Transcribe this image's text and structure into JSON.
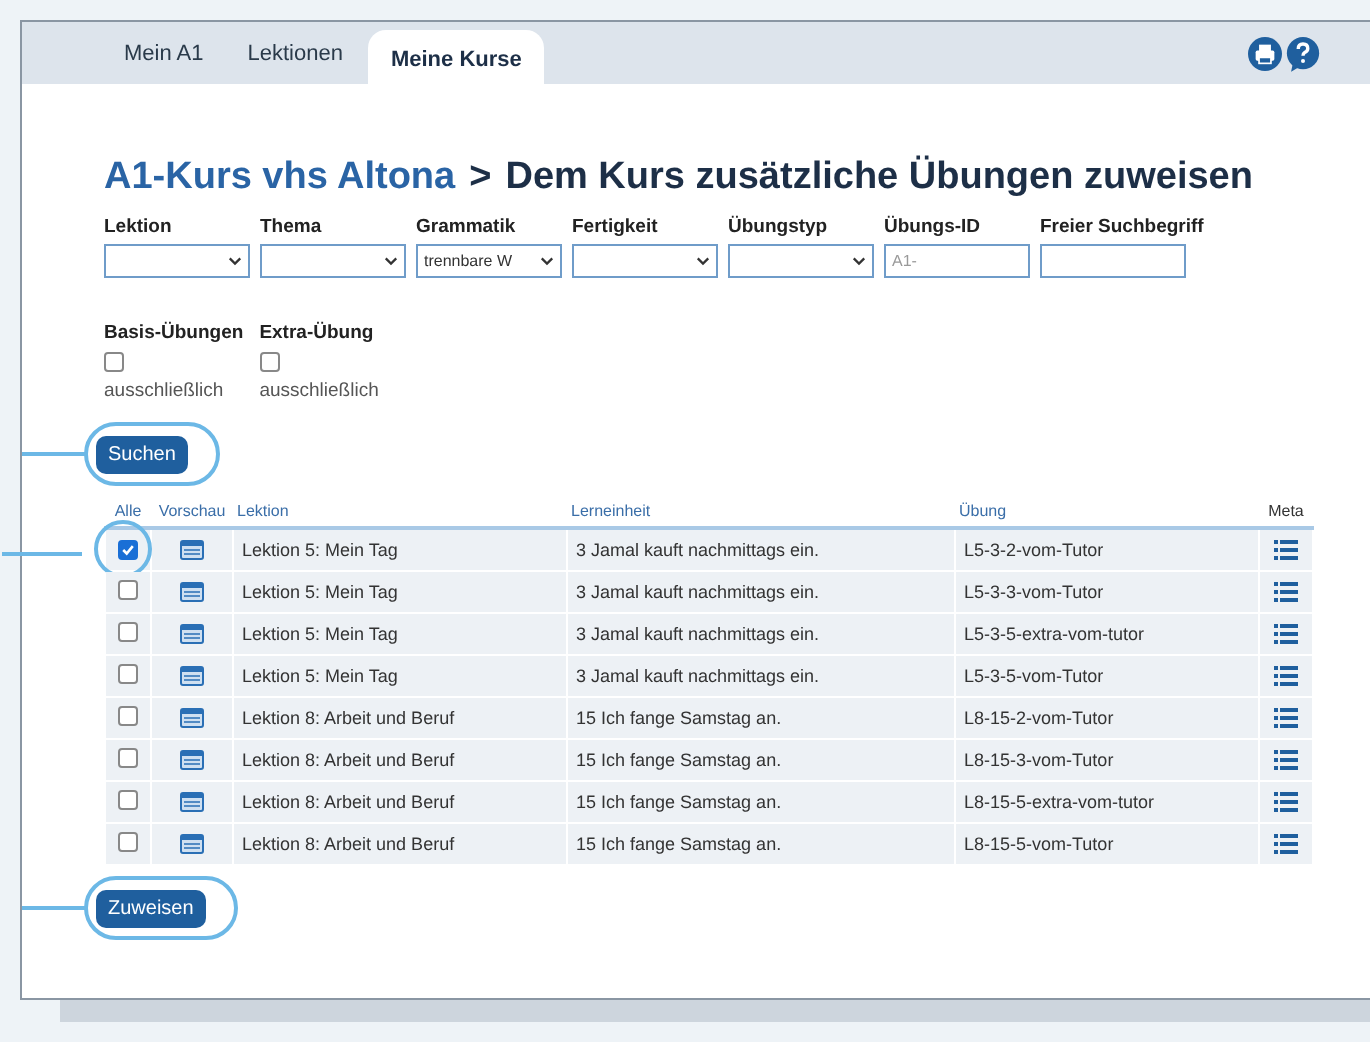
{
  "tabs": [
    {
      "label": "Mein A1",
      "selected": false
    },
    {
      "label": "Lektionen",
      "selected": false
    },
    {
      "label": "Meine Kurse",
      "selected": true
    }
  ],
  "heading": {
    "course": "A1-Kurs vhs Altona",
    "separator": ">",
    "title": "Dem Kurs zusätzliche Übungen zuweisen"
  },
  "filters": [
    {
      "kind": "select",
      "label": "Lektion"
    },
    {
      "kind": "select",
      "label": "Thema"
    },
    {
      "kind": "select",
      "label": "Grammatik",
      "value": "trennbare W"
    },
    {
      "kind": "select",
      "label": "Fertigkeit"
    },
    {
      "kind": "select",
      "label": "Übungstyp"
    },
    {
      "kind": "text",
      "label": "Übungs-ID",
      "placeholder": "A1-"
    },
    {
      "kind": "text",
      "label": "Freier Suchbegriff"
    }
  ],
  "options": [
    {
      "label": "Basis-Übungen",
      "checked": false,
      "note": "ausschließlich"
    },
    {
      "label": "Extra-Übung",
      "checked": false,
      "note": "ausschließlich"
    }
  ],
  "search_button": {
    "label": "Suchen",
    "highlighted": true
  },
  "table": {
    "columns": [
      "Alle",
      "Vorschau",
      "Lektion",
      "Lerneinheit",
      "Übung",
      "Meta"
    ],
    "rows": [
      {
        "checked": true,
        "highlighted": true,
        "lektion": "Lektion 5: Mein Tag",
        "lerneinheit": "3 Jamal kauft nachmittags ein.",
        "uebung": "L5-3-2-vom-Tutor"
      },
      {
        "checked": false,
        "highlighted": false,
        "lektion": "Lektion 5: Mein Tag",
        "lerneinheit": "3 Jamal kauft nachmittags ein.",
        "uebung": "L5-3-3-vom-Tutor"
      },
      {
        "checked": false,
        "highlighted": false,
        "lektion": "Lektion 5: Mein Tag",
        "lerneinheit": "3 Jamal kauft nachmittags ein.",
        "uebung": "L5-3-5-extra-vom-tutor"
      },
      {
        "checked": false,
        "highlighted": false,
        "lektion": "Lektion 5: Mein Tag",
        "lerneinheit": "3 Jamal kauft nachmittags ein.",
        "uebung": "L5-3-5-vom-Tutor"
      },
      {
        "checked": false,
        "highlighted": false,
        "lektion": "Lektion 8: Arbeit und Beruf",
        "lerneinheit": "15 Ich fange Samstag an.",
        "uebung": "L8-15-2-vom-Tutor"
      },
      {
        "checked": false,
        "highlighted": false,
        "lektion": "Lektion 8: Arbeit und Beruf",
        "lerneinheit": "15 Ich fange Samstag an.",
        "uebung": "L8-15-3-vom-Tutor"
      },
      {
        "checked": false,
        "highlighted": false,
        "lektion": "Lektion 8: Arbeit und Beruf",
        "lerneinheit": "15 Ich fange Samstag an.",
        "uebung": "L8-15-5-extra-vom-tutor"
      },
      {
        "checked": false,
        "highlighted": false,
        "lektion": "Lektion 8: Arbeit und Beruf",
        "lerneinheit": "15 Ich fange Samstag an.",
        "uebung": "L8-15-5-vom-Tutor"
      }
    ]
  },
  "assign_button": {
    "label": "Zuweisen",
    "highlighted": true
  }
}
